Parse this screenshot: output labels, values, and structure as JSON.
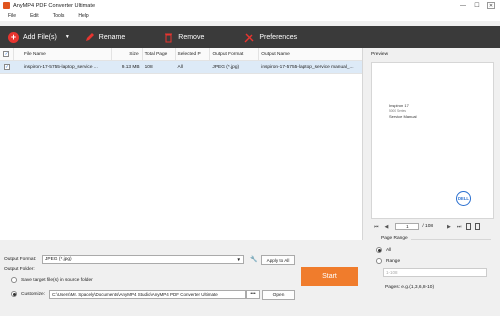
{
  "window": {
    "title": "AnyMP4 PDF Converter Ultimate",
    "minimize_glyph": "—",
    "maximize_glyph": "☐",
    "close_glyph": "✕"
  },
  "menu": [
    "File",
    "Edit",
    "Tools",
    "Help"
  ],
  "toolbar": {
    "add_files": "Add File(s)",
    "rename": "Rename",
    "remove": "Remove",
    "preferences": "Preferences"
  },
  "file_list": {
    "columns": [
      "File Name",
      "Size",
      "Total Page",
      "Selected P",
      "Output Format",
      "Output Name"
    ],
    "rows": [
      {
        "checked": true,
        "file_name": "inspiron-17-5755-laptop_service ...",
        "size": "9.13 MB",
        "total_page": "108",
        "selected_pages": "All",
        "output_format": "JPEG (*.jpg)",
        "output_name": "inspiron-17-5755-laptop_service manual_..."
      }
    ]
  },
  "preview": {
    "label": "Preview",
    "doc_line1": "Inspiron 17",
    "doc_line2": "5000 Series",
    "doc_line3": "Service Manual",
    "logo_text": "DELL",
    "current_page": "1",
    "total_pages": "/ 108"
  },
  "page_range": {
    "title": "Page Range",
    "all_label": "All",
    "range_label": "Range",
    "range_placeholder": "1-108",
    "hint": "Pages: e.g.(1,3,6,8-10)",
    "selected": "All"
  },
  "output": {
    "format_label": "Output Format:",
    "format_value": "JPEG (*.jpg)",
    "apply_all": "Apply to All",
    "folder_label": "Output Folder:",
    "save_source_label": "Save target file(s) in source folder",
    "customize_label": "Customize:",
    "path": "C:\\Users\\Mr. Spacely\\Documents\\AnyMP4 Studio\\AnyMP4 PDF Converter Ultimate",
    "dots": "•••",
    "open": "Open",
    "start": "Start",
    "selected_option": "Customize"
  },
  "colors": {
    "toolbar_bg": "#3a3a3a",
    "accent_orange": "#f07c2c",
    "add_red": "#e8342f",
    "row_selected": "#ddeaf7"
  }
}
